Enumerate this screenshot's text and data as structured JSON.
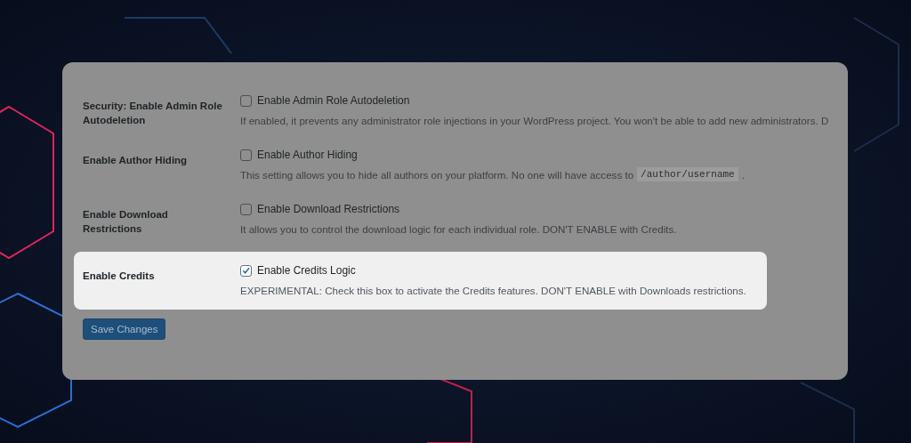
{
  "settings": [
    {
      "label": "Security: Enable Admin Role Autodeletion",
      "checkbox_label": "Enable Admin Role Autodeletion",
      "checked": false,
      "highlighted": false,
      "description": "If enabled, it prevents any administrator role injections in your WordPress project. You won't be able to add new administrators. D"
    },
    {
      "label": "Enable Author Hiding",
      "checkbox_label": "Enable Author Hiding",
      "checked": false,
      "highlighted": false,
      "description": "This setting allows you to hide all authors on your platform. No one will have access to",
      "code": "/author/username",
      "description_end": "."
    },
    {
      "label": "Enable Download Restrictions",
      "checkbox_label": "Enable Download Restrictions",
      "checked": false,
      "highlighted": false,
      "description": "It allows you to control the download logic for each individual role. DON'T ENABLE with Credits."
    },
    {
      "label": "Enable Credits",
      "checkbox_label": "Enable Credits Logic",
      "checked": true,
      "highlighted": true,
      "description": "EXPERIMENTAL: Check this box to activate the Credits features. DON'T ENABLE with Downloads restrictions."
    }
  ],
  "save_button": "Save Changes"
}
